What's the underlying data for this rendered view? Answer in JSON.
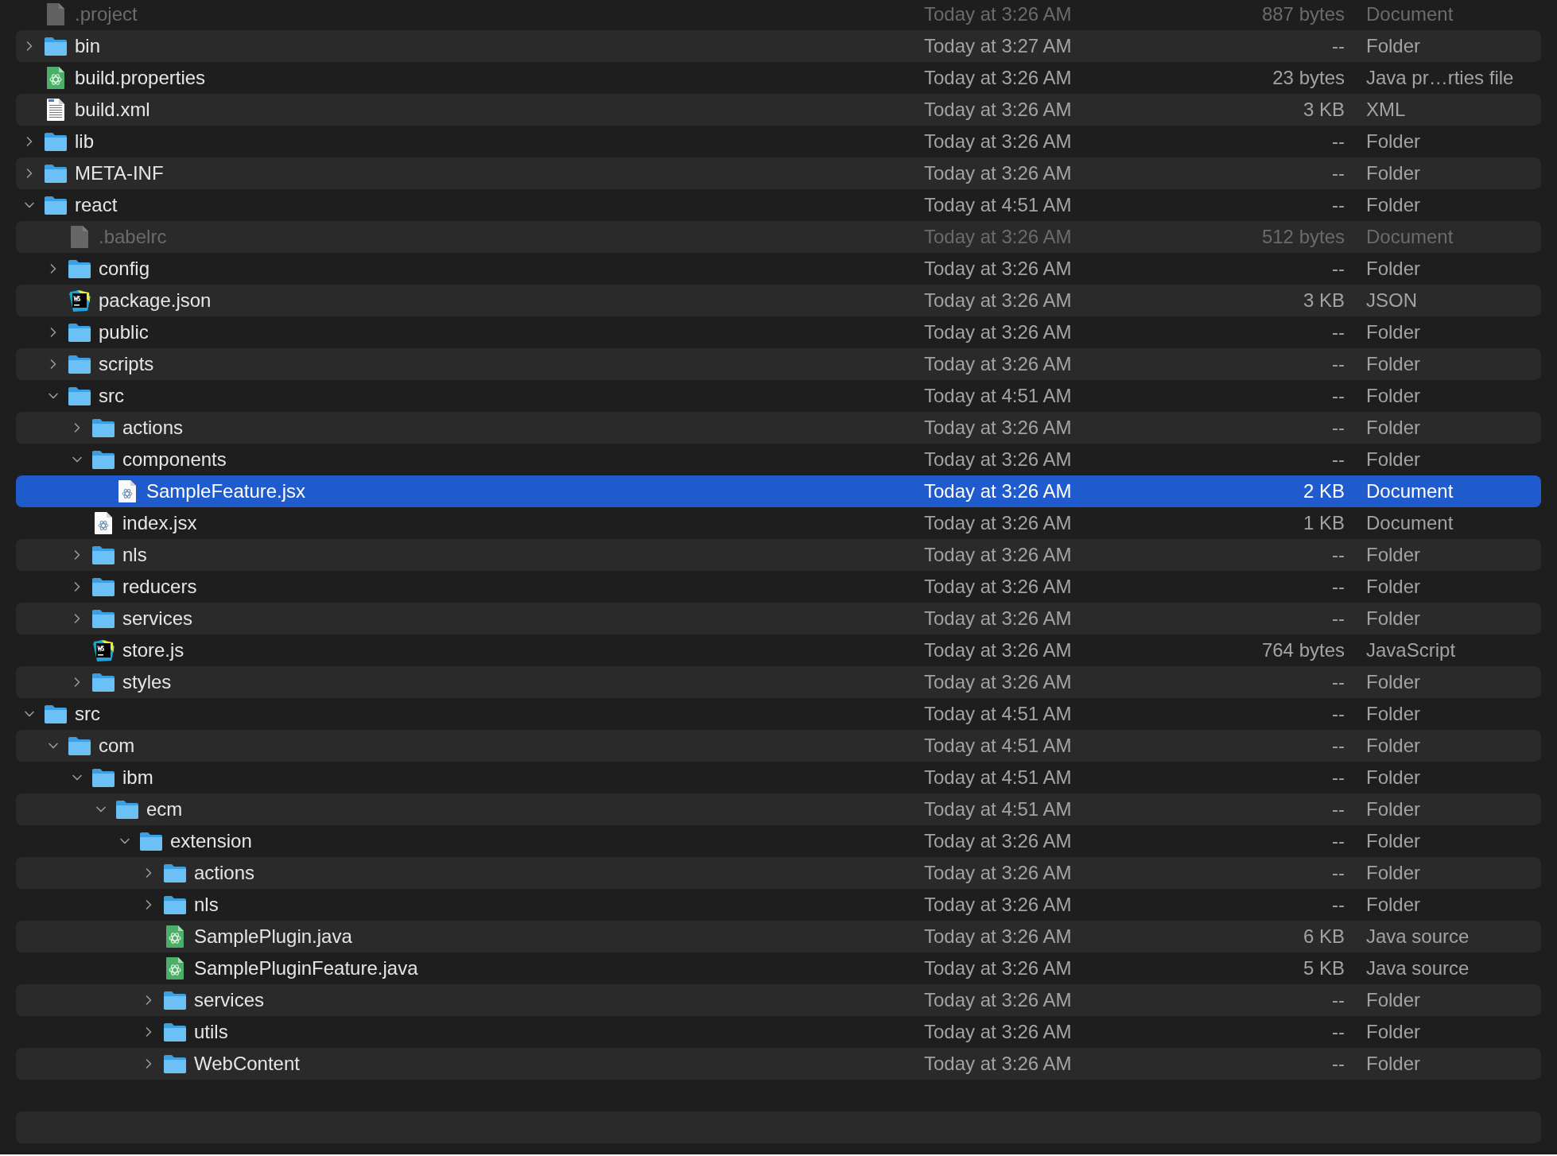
{
  "files": [
    {
      "name": ".project",
      "kind": "document",
      "date": "Today at 3:26 AM",
      "size": "887 bytes",
      "type": "Document",
      "dimmed": true,
      "selected": false
    },
    {
      "name": "bin",
      "kind": "folder",
      "date": "Today at 3:27 AM",
      "size": "--",
      "type": "Folder",
      "expanded": false,
      "dimmed": false,
      "selected": false
    },
    {
      "name": "build.properties",
      "kind": "java",
      "date": "Today at 3:26 AM",
      "size": "23 bytes",
      "type": "Java pr…rties file",
      "dimmed": false,
      "selected": false
    },
    {
      "name": "build.xml",
      "kind": "xml",
      "date": "Today at 3:26 AM",
      "size": "3 KB",
      "type": "XML",
      "dimmed": false,
      "selected": false
    },
    {
      "name": "lib",
      "kind": "folder",
      "date": "Today at 3:26 AM",
      "size": "--",
      "type": "Folder",
      "expanded": false,
      "dimmed": false,
      "selected": false
    },
    {
      "name": "META-INF",
      "kind": "folder",
      "date": "Today at 3:26 AM",
      "size": "--",
      "type": "Folder",
      "expanded": false,
      "dimmed": false,
      "selected": false
    },
    {
      "name": "react",
      "kind": "folder",
      "date": "Today at 4:51 AM",
      "size": "--",
      "type": "Folder",
      "expanded": true,
      "dimmed": false,
      "selected": false,
      "children": [
        {
          "name": ".babelrc",
          "kind": "document",
          "date": "Today at 3:26 AM",
          "size": "512 bytes",
          "type": "Document",
          "dimmed": true,
          "selected": false
        },
        {
          "name": "config",
          "kind": "folder",
          "date": "Today at 3:26 AM",
          "size": "--",
          "type": "Folder",
          "expanded": false,
          "dimmed": false,
          "selected": false
        },
        {
          "name": "package.json",
          "kind": "webstorm",
          "date": "Today at 3:26 AM",
          "size": "3 KB",
          "type": "JSON",
          "dimmed": false,
          "selected": false
        },
        {
          "name": "public",
          "kind": "folder",
          "date": "Today at 3:26 AM",
          "size": "--",
          "type": "Folder",
          "expanded": false,
          "dimmed": false,
          "selected": false
        },
        {
          "name": "scripts",
          "kind": "folder",
          "date": "Today at 3:26 AM",
          "size": "--",
          "type": "Folder",
          "expanded": false,
          "dimmed": false,
          "selected": false
        },
        {
          "name": "src",
          "kind": "folder",
          "date": "Today at 4:51 AM",
          "size": "--",
          "type": "Folder",
          "expanded": true,
          "dimmed": false,
          "selected": false,
          "children": [
            {
              "name": "actions",
              "kind": "folder",
              "date": "Today at 3:26 AM",
              "size": "--",
              "type": "Folder",
              "expanded": false,
              "dimmed": false,
              "selected": false
            },
            {
              "name": "components",
              "kind": "folder",
              "date": "Today at 3:26 AM",
              "size": "--",
              "type": "Folder",
              "expanded": true,
              "dimmed": false,
              "selected": false,
              "children": [
                {
                  "name": "SampleFeature.jsx",
                  "kind": "react",
                  "date": "Today at 3:26 AM",
                  "size": "2 KB",
                  "type": "Document",
                  "dimmed": false,
                  "selected": true
                }
              ]
            },
            {
              "name": "index.jsx",
              "kind": "react",
              "date": "Today at 3:26 AM",
              "size": "1 KB",
              "type": "Document",
              "dimmed": false,
              "selected": false
            },
            {
              "name": "nls",
              "kind": "folder",
              "date": "Today at 3:26 AM",
              "size": "--",
              "type": "Folder",
              "expanded": false,
              "dimmed": false,
              "selected": false
            },
            {
              "name": "reducers",
              "kind": "folder",
              "date": "Today at 3:26 AM",
              "size": "--",
              "type": "Folder",
              "expanded": false,
              "dimmed": false,
              "selected": false
            },
            {
              "name": "services",
              "kind": "folder",
              "date": "Today at 3:26 AM",
              "size": "--",
              "type": "Folder",
              "expanded": false,
              "dimmed": false,
              "selected": false
            },
            {
              "name": "store.js",
              "kind": "webstorm",
              "date": "Today at 3:26 AM",
              "size": "764 bytes",
              "type": "JavaScript",
              "dimmed": false,
              "selected": false
            },
            {
              "name": "styles",
              "kind": "folder",
              "date": "Today at 3:26 AM",
              "size": "--",
              "type": "Folder",
              "expanded": false,
              "dimmed": false,
              "selected": false
            }
          ]
        }
      ]
    },
    {
      "name": "src",
      "kind": "folder",
      "date": "Today at 4:51 AM",
      "size": "--",
      "type": "Folder",
      "expanded": true,
      "dimmed": false,
      "selected": false,
      "children": [
        {
          "name": "com",
          "kind": "folder",
          "date": "Today at 4:51 AM",
          "size": "--",
          "type": "Folder",
          "expanded": true,
          "dimmed": false,
          "selected": false,
          "children": [
            {
              "name": "ibm",
              "kind": "folder",
              "date": "Today at 4:51 AM",
              "size": "--",
              "type": "Folder",
              "expanded": true,
              "dimmed": false,
              "selected": false,
              "children": [
                {
                  "name": "ecm",
                  "kind": "folder",
                  "date": "Today at 4:51 AM",
                  "size": "--",
                  "type": "Folder",
                  "expanded": true,
                  "dimmed": false,
                  "selected": false,
                  "children": [
                    {
                      "name": "extension",
                      "kind": "folder",
                      "date": "Today at 3:26 AM",
                      "size": "--",
                      "type": "Folder",
                      "expanded": true,
                      "dimmed": false,
                      "selected": false,
                      "children": [
                        {
                          "name": "actions",
                          "kind": "folder",
                          "date": "Today at 3:26 AM",
                          "size": "--",
                          "type": "Folder",
                          "expanded": false,
                          "dimmed": false,
                          "selected": false
                        },
                        {
                          "name": "nls",
                          "kind": "folder",
                          "date": "Today at 3:26 AM",
                          "size": "--",
                          "type": "Folder",
                          "expanded": false,
                          "dimmed": false,
                          "selected": false
                        },
                        {
                          "name": "SamplePlugin.java",
                          "kind": "java",
                          "date": "Today at 3:26 AM",
                          "size": "6 KB",
                          "type": "Java source",
                          "dimmed": false,
                          "selected": false
                        },
                        {
                          "name": "SamplePluginFeature.java",
                          "kind": "java",
                          "date": "Today at 3:26 AM",
                          "size": "5 KB",
                          "type": "Java source",
                          "dimmed": false,
                          "selected": false
                        },
                        {
                          "name": "services",
                          "kind": "folder",
                          "date": "Today at 3:26 AM",
                          "size": "--",
                          "type": "Folder",
                          "expanded": false,
                          "dimmed": false,
                          "selected": false
                        },
                        {
                          "name": "utils",
                          "kind": "folder",
                          "date": "Today at 3:26 AM",
                          "size": "--",
                          "type": "Folder",
                          "expanded": false,
                          "dimmed": false,
                          "selected": false
                        },
                        {
                          "name": "WebContent",
                          "kind": "folder",
                          "date": "Today at 3:26 AM",
                          "size": "--",
                          "type": "Folder",
                          "expanded": false,
                          "dimmed": false,
                          "selected": false
                        }
                      ]
                    }
                  ]
                }
              ]
            }
          ]
        }
      ]
    }
  ]
}
